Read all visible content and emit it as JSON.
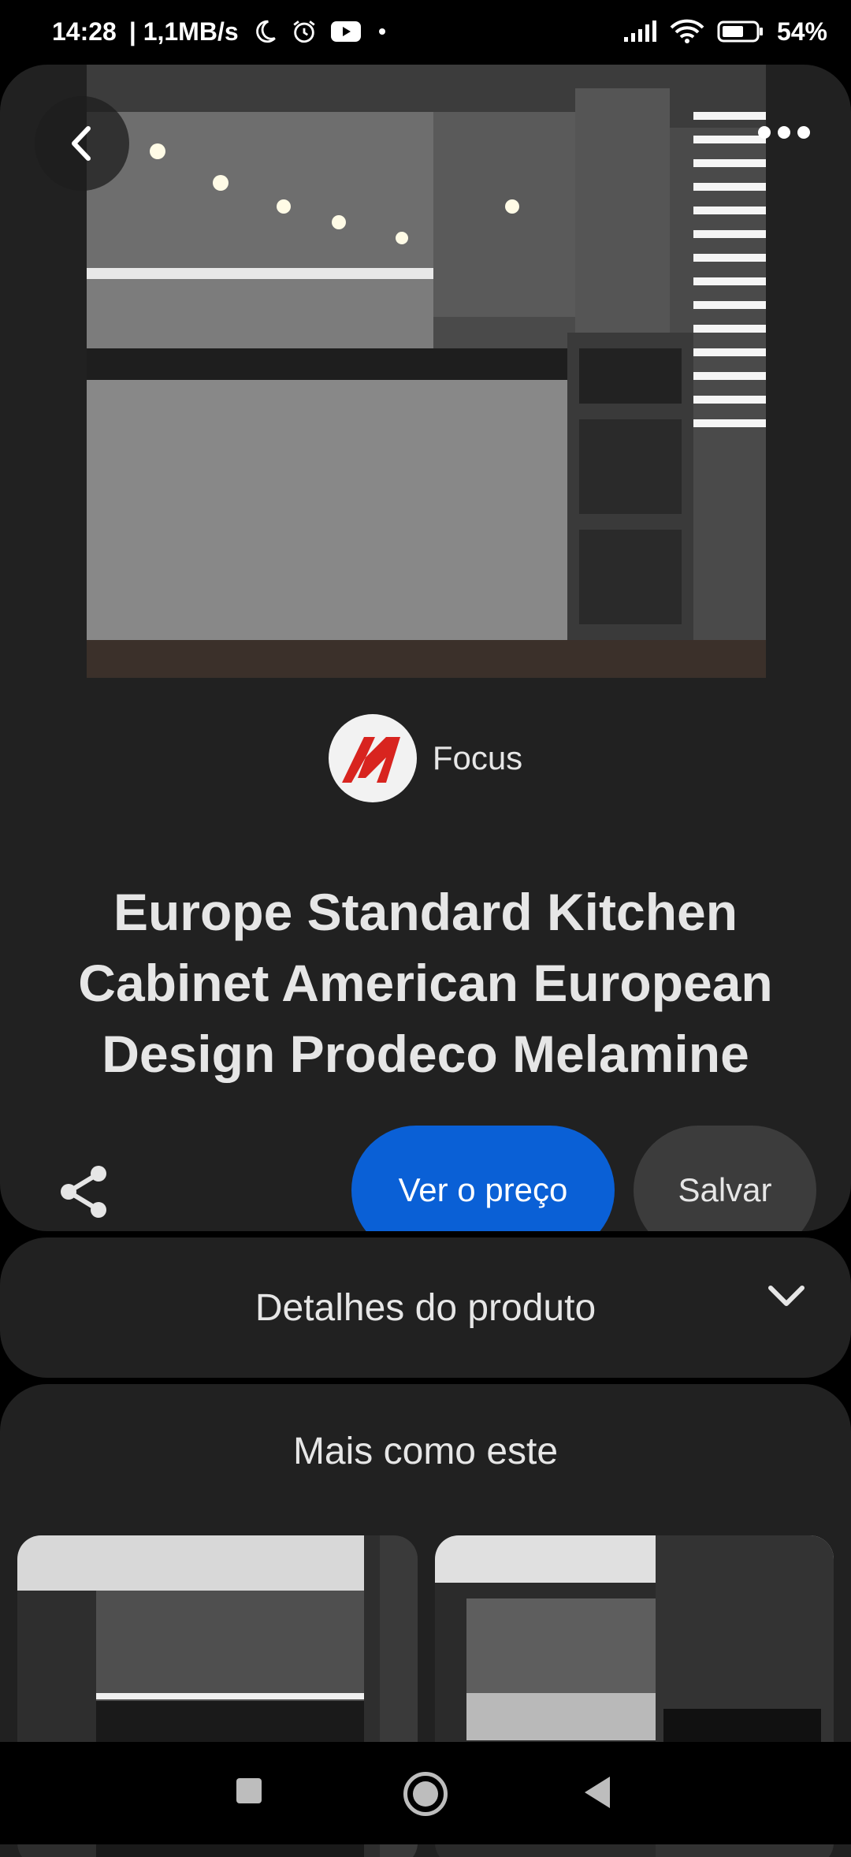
{
  "status_bar": {
    "time": "14:28",
    "network_speed": "| 1,1MB/s",
    "battery": "54%",
    "icons": [
      "moon-icon",
      "alarm-icon",
      "youtube-icon",
      "dot-icon",
      "signal-icon",
      "wifi-icon",
      "battery-icon"
    ]
  },
  "pin": {
    "brand": "Focus",
    "title": "Europe Standard Kitchen Cabinet American European Design Prodeco Melamine",
    "price_button": "Ver o preço",
    "save_button": "Salvar"
  },
  "details": {
    "label": "Detalhes do produto"
  },
  "more_like_this": {
    "title": "Mais como este"
  },
  "colors": {
    "accent": "#0a60d6",
    "card": "#212121",
    "save_bg": "#3c3c3c",
    "text": "#e6e6e6"
  }
}
